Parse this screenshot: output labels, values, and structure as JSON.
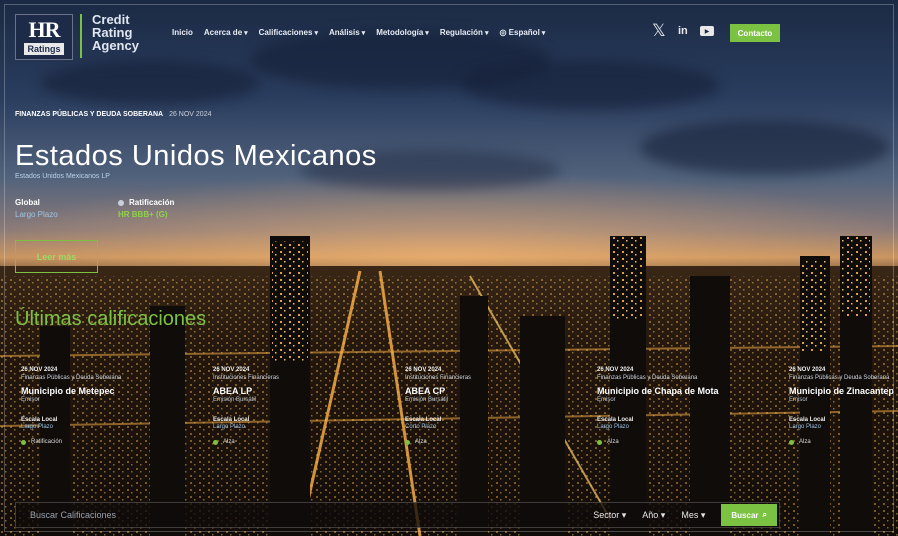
{
  "brand": {
    "logo_main": "HR",
    "logo_sub": "Ratings",
    "agency": [
      "Credit",
      "Rating",
      "Agency"
    ]
  },
  "nav": {
    "items": [
      {
        "label": "Inicio",
        "caret": false
      },
      {
        "label": "Acerca de",
        "caret": true
      },
      {
        "label": "Calificaciones",
        "caret": true
      },
      {
        "label": "Análisis",
        "caret": true
      },
      {
        "label": "Metodología",
        "caret": true
      },
      {
        "label": "Regulación",
        "caret": true
      }
    ],
    "language": "Español",
    "social": [
      "x-icon",
      "linkedin-icon",
      "youtube-icon"
    ],
    "contact": "Contacto"
  },
  "hero": {
    "kicker": "FINANZAS PÚBLICAS Y DEUDA SOBERANA",
    "date": "26 NOV 2024",
    "title": "Estados Unidos Mexicanos",
    "subtitle": "Estados Unidos Mexicanos LP",
    "scale_label": "Global",
    "term": "Largo Plazo",
    "rating_label": "Ratificación",
    "rating_value": "HR BBB+ (G)",
    "cta": "Leer más"
  },
  "latest": {
    "title": "Últimas calificaciones",
    "cards": [
      {
        "date": "26 NOV 2024",
        "sector": "Finanzas Públicas y Deuda Soberana",
        "name": "Municipio de Metepec",
        "type": "Emisor",
        "scale": "Escala Local",
        "term": "Largo Plazo",
        "status": "Ratificación"
      },
      {
        "date": "26 NOV 2024",
        "sector": "Instituciones Financieras",
        "name": "ABEA LP",
        "type": "Emisión Bursátil",
        "scale": "Escala Local",
        "term": "Largo Plazo",
        "status": "Alza"
      },
      {
        "date": "26 NOV 2024",
        "sector": "Instituciones Financieras",
        "name": "ABEA CP",
        "type": "Emisión Bursátil",
        "scale": "Escala Local",
        "term": "Corto Plazo",
        "status": "Alza"
      },
      {
        "date": "26 NOV 2024",
        "sector": "Finanzas Públicas y Deuda Soberana",
        "name": "Municipio de Chapa de Mota",
        "type": "Emisor",
        "scale": "Escala Local",
        "term": "Largo Plazo",
        "status": "Alza"
      },
      {
        "date": "26 NOV 2024",
        "sector": "Finanzas Públicas y Deuda Soberana",
        "name": "Municipio de Zinacantepec",
        "type": "Emisor",
        "scale": "Escala Local",
        "term": "Largo Plazo",
        "status": "Alza"
      }
    ]
  },
  "search": {
    "placeholder": "Buscar Calificaciones",
    "sector": "Sector",
    "year": "Año",
    "month": "Mes",
    "button": "Buscar"
  },
  "colors": {
    "accent": "#7cc242",
    "navy": "#1d2a48"
  }
}
